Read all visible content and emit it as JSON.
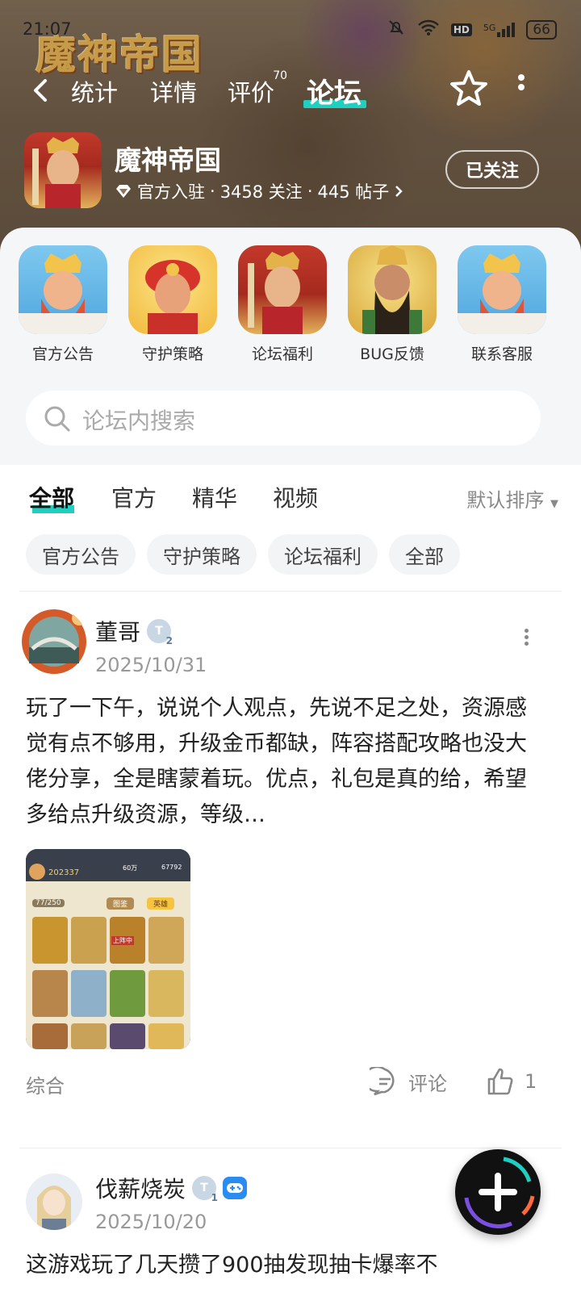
{
  "status_bar": {
    "time": "21:07",
    "network": "5G",
    "hd": "HD",
    "battery": "66"
  },
  "game": {
    "banner_logo": "魔神帝国",
    "name": "魔神帝国",
    "verified": "官方入驻",
    "followers": "3458 关注",
    "posts": "445 帖子",
    "follow_label": "已关注"
  },
  "nav": {
    "tabs": [
      {
        "label": "统计"
      },
      {
        "label": "详情"
      },
      {
        "label": "评价",
        "badge": "70"
      },
      {
        "label": "论坛"
      }
    ]
  },
  "shortcuts": [
    {
      "label": "官方公告"
    },
    {
      "label": "守护策略"
    },
    {
      "label": "论坛福利"
    },
    {
      "label": "BUG反馈"
    },
    {
      "label": "联系客服"
    }
  ],
  "search": {
    "placeholder": "论坛内搜索"
  },
  "filter_tabs": [
    {
      "label": "全部"
    },
    {
      "label": "官方"
    },
    {
      "label": "精华"
    },
    {
      "label": "视频"
    }
  ],
  "sort_label": "默认排序",
  "chips": [
    {
      "label": "官方公告"
    },
    {
      "label": "守护策略"
    },
    {
      "label": "论坛福利"
    },
    {
      "label": "全部"
    }
  ],
  "posts": [
    {
      "author": "董哥",
      "level": "2",
      "date": "2025/10/31",
      "body": "玩了一下午，说说个人观点，先说不足之处，资源感觉有点不够用，升级金币都缺，阵容搭配攻略也没大佬分享，全是瞎蒙着玩。优点，礼包是真的给，希望多给点升级资源，等级…",
      "image_text": {
        "score": "202337",
        "count": "77/250",
        "gold": "60万",
        "gems": "67792",
        "tabs": [
          "图鉴",
          "英雄"
        ],
        "status": "上阵中"
      },
      "category": "综合",
      "comment_label": "评论",
      "likes": "1"
    },
    {
      "author": "伐薪烧炭",
      "level": "1",
      "date": "2025/10/20",
      "body": "这游戏玩了几天攒了900抽发现抽卡爆率不"
    }
  ]
}
